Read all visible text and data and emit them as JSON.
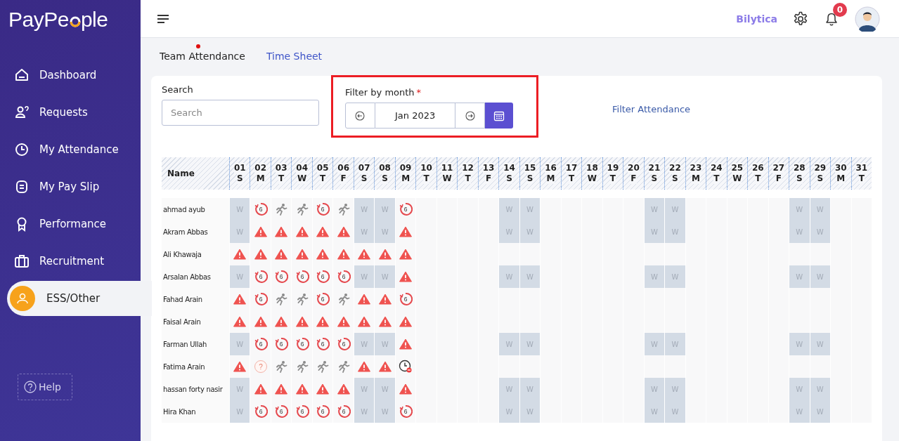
{
  "sidebar": {
    "logo": {
      "text_before": "PayPe",
      "text_after": "ple"
    },
    "items": [
      {
        "label": "Dashboard",
        "selected": false
      },
      {
        "label": "Requests",
        "selected": false
      },
      {
        "label": "My Attendance",
        "selected": false
      },
      {
        "label": "My Pay Slip",
        "selected": false
      },
      {
        "label": "Performance",
        "selected": false
      },
      {
        "label": "Recruitment",
        "selected": false
      },
      {
        "label": "ESS/Other",
        "selected": true
      }
    ],
    "help_button": "Help"
  },
  "header": {
    "company": "Bilytica",
    "notification_count": "0"
  },
  "tabs": [
    {
      "label": "Team Attendance",
      "selected": true
    },
    {
      "label": "Time Sheet",
      "selected": false
    }
  ],
  "filters": {
    "search_label": "Search",
    "search_placeholder": "Search",
    "month_label": "Filter by month",
    "required_mark": "*",
    "month_value": "Jan 2023",
    "filter_link": "Filter Attendance"
  },
  "table": {
    "name_header": "Name",
    "days": [
      {
        "date": "01",
        "weekday": "S"
      },
      {
        "date": "02",
        "weekday": "M"
      },
      {
        "date": "03",
        "weekday": "T"
      },
      {
        "date": "04",
        "weekday": "W"
      },
      {
        "date": "05",
        "weekday": "T"
      },
      {
        "date": "06",
        "weekday": "F"
      },
      {
        "date": "07",
        "weekday": "S"
      },
      {
        "date": "08",
        "weekday": "S"
      },
      {
        "date": "09",
        "weekday": "M"
      },
      {
        "date": "10",
        "weekday": "T"
      },
      {
        "date": "11",
        "weekday": "W"
      },
      {
        "date": "12",
        "weekday": "T"
      },
      {
        "date": "13",
        "weekday": "F"
      },
      {
        "date": "14",
        "weekday": "S"
      },
      {
        "date": "15",
        "weekday": "S"
      },
      {
        "date": "16",
        "weekday": "M"
      },
      {
        "date": "17",
        "weekday": "T"
      },
      {
        "date": "18",
        "weekday": "W"
      },
      {
        "date": "19",
        "weekday": "T"
      },
      {
        "date": "20",
        "weekday": "F"
      },
      {
        "date": "21",
        "weekday": "S"
      },
      {
        "date": "22",
        "weekday": "S"
      },
      {
        "date": "23",
        "weekday": "M"
      },
      {
        "date": "24",
        "weekday": "T"
      },
      {
        "date": "25",
        "weekday": "W"
      },
      {
        "date": "26",
        "weekday": "T"
      },
      {
        "date": "27",
        "weekday": "F"
      },
      {
        "date": "28",
        "weekday": "S"
      },
      {
        "date": "29",
        "weekday": "S"
      },
      {
        "date": "30",
        "weekday": "M"
      },
      {
        "date": "31",
        "weekday": "T"
      }
    ],
    "rows": [
      {
        "name": "ahmad ayub",
        "cells": [
          {
            "kind": "weekend",
            "text": "W"
          },
          {
            "kind": "leave",
            "text": "6"
          },
          {
            "kind": "present"
          },
          {
            "kind": "present"
          },
          {
            "kind": "leave",
            "text": "6"
          },
          {
            "kind": "present"
          },
          {
            "kind": "weekend",
            "text": "W"
          },
          {
            "kind": "weekend",
            "text": "W"
          },
          {
            "kind": "leave",
            "text": "6"
          },
          {
            "kind": "empty"
          },
          {
            "kind": "empty"
          },
          {
            "kind": "empty"
          },
          {
            "kind": "empty"
          },
          {
            "kind": "weekend",
            "text": "W"
          },
          {
            "kind": "weekend",
            "text": "W"
          },
          {
            "kind": "empty"
          },
          {
            "kind": "empty"
          },
          {
            "kind": "empty"
          },
          {
            "kind": "empty"
          },
          {
            "kind": "empty"
          },
          {
            "kind": "weekend",
            "text": "W"
          },
          {
            "kind": "weekend",
            "text": "W"
          },
          {
            "kind": "empty"
          },
          {
            "kind": "empty"
          },
          {
            "kind": "empty"
          },
          {
            "kind": "empty"
          },
          {
            "kind": "empty"
          },
          {
            "kind": "weekend",
            "text": "W"
          },
          {
            "kind": "weekend",
            "text": "W"
          },
          {
            "kind": "empty"
          },
          {
            "kind": "empty"
          }
        ]
      },
      {
        "name": "Akram Abbas",
        "cells": [
          {
            "kind": "weekend",
            "text": "W"
          },
          {
            "kind": "absent"
          },
          {
            "kind": "absent"
          },
          {
            "kind": "absent"
          },
          {
            "kind": "absent"
          },
          {
            "kind": "absent"
          },
          {
            "kind": "weekend",
            "text": "W"
          },
          {
            "kind": "weekend",
            "text": "W"
          },
          {
            "kind": "absent"
          },
          {
            "kind": "empty"
          },
          {
            "kind": "empty"
          },
          {
            "kind": "empty"
          },
          {
            "kind": "empty"
          },
          {
            "kind": "weekend",
            "text": "W"
          },
          {
            "kind": "weekend",
            "text": "W"
          },
          {
            "kind": "empty"
          },
          {
            "kind": "empty"
          },
          {
            "kind": "empty"
          },
          {
            "kind": "empty"
          },
          {
            "kind": "empty"
          },
          {
            "kind": "weekend",
            "text": "W"
          },
          {
            "kind": "weekend",
            "text": "W"
          },
          {
            "kind": "empty"
          },
          {
            "kind": "empty"
          },
          {
            "kind": "empty"
          },
          {
            "kind": "empty"
          },
          {
            "kind": "empty"
          },
          {
            "kind": "weekend",
            "text": "W"
          },
          {
            "kind": "weekend",
            "text": "W"
          },
          {
            "kind": "empty"
          },
          {
            "kind": "empty"
          }
        ]
      },
      {
        "name": "Ali Khawaja",
        "cells": [
          {
            "kind": "absent"
          },
          {
            "kind": "absent"
          },
          {
            "kind": "absent"
          },
          {
            "kind": "absent"
          },
          {
            "kind": "absent"
          },
          {
            "kind": "absent"
          },
          {
            "kind": "absent"
          },
          {
            "kind": "absent"
          },
          {
            "kind": "absent"
          },
          {
            "kind": "empty"
          },
          {
            "kind": "empty"
          },
          {
            "kind": "empty"
          },
          {
            "kind": "empty"
          },
          {
            "kind": "empty"
          },
          {
            "kind": "empty"
          },
          {
            "kind": "empty"
          },
          {
            "kind": "empty"
          },
          {
            "kind": "empty"
          },
          {
            "kind": "empty"
          },
          {
            "kind": "empty"
          },
          {
            "kind": "empty"
          },
          {
            "kind": "empty"
          },
          {
            "kind": "empty"
          },
          {
            "kind": "empty"
          },
          {
            "kind": "empty"
          },
          {
            "kind": "empty"
          },
          {
            "kind": "empty"
          },
          {
            "kind": "empty"
          },
          {
            "kind": "empty"
          },
          {
            "kind": "empty"
          },
          {
            "kind": "empty"
          }
        ]
      },
      {
        "name": "Arsalan Abbas",
        "cells": [
          {
            "kind": "weekend",
            "text": "W"
          },
          {
            "kind": "leave",
            "text": "6"
          },
          {
            "kind": "leave",
            "text": "6"
          },
          {
            "kind": "leave",
            "text": "6"
          },
          {
            "kind": "leave",
            "text": "6"
          },
          {
            "kind": "leave",
            "text": "6"
          },
          {
            "kind": "weekend",
            "text": "W"
          },
          {
            "kind": "weekend",
            "text": "W"
          },
          {
            "kind": "absent"
          },
          {
            "kind": "empty"
          },
          {
            "kind": "empty"
          },
          {
            "kind": "empty"
          },
          {
            "kind": "empty"
          },
          {
            "kind": "weekend",
            "text": "W"
          },
          {
            "kind": "weekend",
            "text": "W"
          },
          {
            "kind": "empty"
          },
          {
            "kind": "empty"
          },
          {
            "kind": "empty"
          },
          {
            "kind": "empty"
          },
          {
            "kind": "empty"
          },
          {
            "kind": "weekend",
            "text": "W"
          },
          {
            "kind": "weekend",
            "text": "W"
          },
          {
            "kind": "empty"
          },
          {
            "kind": "empty"
          },
          {
            "kind": "empty"
          },
          {
            "kind": "empty"
          },
          {
            "kind": "empty"
          },
          {
            "kind": "weekend",
            "text": "W"
          },
          {
            "kind": "weekend",
            "text": "W"
          },
          {
            "kind": "empty"
          },
          {
            "kind": "empty"
          }
        ]
      },
      {
        "name": "Fahad Arain",
        "cells": [
          {
            "kind": "absent"
          },
          {
            "kind": "leave",
            "text": "6"
          },
          {
            "kind": "present"
          },
          {
            "kind": "present"
          },
          {
            "kind": "leave",
            "text": "6"
          },
          {
            "kind": "present"
          },
          {
            "kind": "absent"
          },
          {
            "kind": "absent"
          },
          {
            "kind": "leave",
            "text": "6"
          },
          {
            "kind": "empty"
          },
          {
            "kind": "empty"
          },
          {
            "kind": "empty"
          },
          {
            "kind": "empty"
          },
          {
            "kind": "empty"
          },
          {
            "kind": "empty"
          },
          {
            "kind": "empty"
          },
          {
            "kind": "empty"
          },
          {
            "kind": "empty"
          },
          {
            "kind": "empty"
          },
          {
            "kind": "empty"
          },
          {
            "kind": "empty"
          },
          {
            "kind": "empty"
          },
          {
            "kind": "empty"
          },
          {
            "kind": "empty"
          },
          {
            "kind": "empty"
          },
          {
            "kind": "empty"
          },
          {
            "kind": "empty"
          },
          {
            "kind": "empty"
          },
          {
            "kind": "empty"
          },
          {
            "kind": "empty"
          },
          {
            "kind": "empty"
          }
        ]
      },
      {
        "name": "Faisal Arain",
        "cells": [
          {
            "kind": "absent"
          },
          {
            "kind": "absent"
          },
          {
            "kind": "absent"
          },
          {
            "kind": "absent"
          },
          {
            "kind": "absent"
          },
          {
            "kind": "absent"
          },
          {
            "kind": "absent"
          },
          {
            "kind": "absent"
          },
          {
            "kind": "absent"
          },
          {
            "kind": "empty"
          },
          {
            "kind": "empty"
          },
          {
            "kind": "empty"
          },
          {
            "kind": "empty"
          },
          {
            "kind": "empty"
          },
          {
            "kind": "empty"
          },
          {
            "kind": "empty"
          },
          {
            "kind": "empty"
          },
          {
            "kind": "empty"
          },
          {
            "kind": "empty"
          },
          {
            "kind": "empty"
          },
          {
            "kind": "empty"
          },
          {
            "kind": "empty"
          },
          {
            "kind": "empty"
          },
          {
            "kind": "empty"
          },
          {
            "kind": "empty"
          },
          {
            "kind": "empty"
          },
          {
            "kind": "empty"
          },
          {
            "kind": "empty"
          },
          {
            "kind": "empty"
          },
          {
            "kind": "empty"
          },
          {
            "kind": "empty"
          }
        ]
      },
      {
        "name": "Farman Ullah",
        "cells": [
          {
            "kind": "weekend",
            "text": "W"
          },
          {
            "kind": "leave",
            "text": "6"
          },
          {
            "kind": "leave",
            "text": "6"
          },
          {
            "kind": "leave",
            "text": "6"
          },
          {
            "kind": "leave",
            "text": "6"
          },
          {
            "kind": "leave",
            "text": "6"
          },
          {
            "kind": "weekend",
            "text": "W"
          },
          {
            "kind": "weekend",
            "text": "W"
          },
          {
            "kind": "absent"
          },
          {
            "kind": "empty"
          },
          {
            "kind": "empty"
          },
          {
            "kind": "empty"
          },
          {
            "kind": "empty"
          },
          {
            "kind": "weekend",
            "text": "W"
          },
          {
            "kind": "weekend",
            "text": "W"
          },
          {
            "kind": "empty"
          },
          {
            "kind": "empty"
          },
          {
            "kind": "empty"
          },
          {
            "kind": "empty"
          },
          {
            "kind": "empty"
          },
          {
            "kind": "weekend",
            "text": "W"
          },
          {
            "kind": "weekend",
            "text": "W"
          },
          {
            "kind": "empty"
          },
          {
            "kind": "empty"
          },
          {
            "kind": "empty"
          },
          {
            "kind": "empty"
          },
          {
            "kind": "empty"
          },
          {
            "kind": "weekend",
            "text": "W"
          },
          {
            "kind": "weekend",
            "text": "W"
          },
          {
            "kind": "empty"
          },
          {
            "kind": "empty"
          }
        ]
      },
      {
        "name": "Fatima Arain",
        "cells": [
          {
            "kind": "absent"
          },
          {
            "kind": "unknown",
            "text": "?"
          },
          {
            "kind": "present"
          },
          {
            "kind": "present"
          },
          {
            "kind": "present"
          },
          {
            "kind": "present"
          },
          {
            "kind": "absent"
          },
          {
            "kind": "absent"
          },
          {
            "kind": "late"
          },
          {
            "kind": "empty"
          },
          {
            "kind": "empty"
          },
          {
            "kind": "empty"
          },
          {
            "kind": "empty"
          },
          {
            "kind": "empty"
          },
          {
            "kind": "empty"
          },
          {
            "kind": "empty"
          },
          {
            "kind": "empty"
          },
          {
            "kind": "empty"
          },
          {
            "kind": "empty"
          },
          {
            "kind": "empty"
          },
          {
            "kind": "empty"
          },
          {
            "kind": "empty"
          },
          {
            "kind": "empty"
          },
          {
            "kind": "empty"
          },
          {
            "kind": "empty"
          },
          {
            "kind": "empty"
          },
          {
            "kind": "empty"
          },
          {
            "kind": "empty"
          },
          {
            "kind": "empty"
          },
          {
            "kind": "empty"
          },
          {
            "kind": "empty"
          }
        ]
      },
      {
        "name": "hassan forty nasir",
        "cells": [
          {
            "kind": "weekend",
            "text": "W"
          },
          {
            "kind": "absent"
          },
          {
            "kind": "absent"
          },
          {
            "kind": "absent"
          },
          {
            "kind": "absent"
          },
          {
            "kind": "absent"
          },
          {
            "kind": "weekend",
            "text": "W"
          },
          {
            "kind": "weekend",
            "text": "W"
          },
          {
            "kind": "absent"
          },
          {
            "kind": "empty"
          },
          {
            "kind": "empty"
          },
          {
            "kind": "empty"
          },
          {
            "kind": "empty"
          },
          {
            "kind": "weekend",
            "text": "W"
          },
          {
            "kind": "weekend",
            "text": "W"
          },
          {
            "kind": "empty"
          },
          {
            "kind": "empty"
          },
          {
            "kind": "empty"
          },
          {
            "kind": "empty"
          },
          {
            "kind": "empty"
          },
          {
            "kind": "weekend",
            "text": "W"
          },
          {
            "kind": "weekend",
            "text": "W"
          },
          {
            "kind": "empty"
          },
          {
            "kind": "empty"
          },
          {
            "kind": "empty"
          },
          {
            "kind": "empty"
          },
          {
            "kind": "empty"
          },
          {
            "kind": "weekend",
            "text": "W"
          },
          {
            "kind": "weekend",
            "text": "W"
          },
          {
            "kind": "empty"
          },
          {
            "kind": "empty"
          }
        ]
      },
      {
        "name": "Hira Khan",
        "cells": [
          {
            "kind": "weekend",
            "text": "W"
          },
          {
            "kind": "leave",
            "text": "6"
          },
          {
            "kind": "leave",
            "text": "6"
          },
          {
            "kind": "leave",
            "text": "6"
          },
          {
            "kind": "leave",
            "text": "6"
          },
          {
            "kind": "leave",
            "text": "6"
          },
          {
            "kind": "weekend",
            "text": "W"
          },
          {
            "kind": "weekend",
            "text": "W"
          },
          {
            "kind": "leave",
            "text": "6"
          },
          {
            "kind": "empty"
          },
          {
            "kind": "empty"
          },
          {
            "kind": "empty"
          },
          {
            "kind": "empty"
          },
          {
            "kind": "weekend",
            "text": "W"
          },
          {
            "kind": "weekend",
            "text": "W"
          },
          {
            "kind": "empty"
          },
          {
            "kind": "empty"
          },
          {
            "kind": "empty"
          },
          {
            "kind": "empty"
          },
          {
            "kind": "empty"
          },
          {
            "kind": "weekend",
            "text": "W"
          },
          {
            "kind": "weekend",
            "text": "W"
          },
          {
            "kind": "empty"
          },
          {
            "kind": "empty"
          },
          {
            "kind": "empty"
          },
          {
            "kind": "empty"
          },
          {
            "kind": "empty"
          },
          {
            "kind": "weekend",
            "text": "W"
          },
          {
            "kind": "weekend",
            "text": "W"
          },
          {
            "kind": "empty"
          },
          {
            "kind": "empty"
          }
        ]
      }
    ]
  }
}
